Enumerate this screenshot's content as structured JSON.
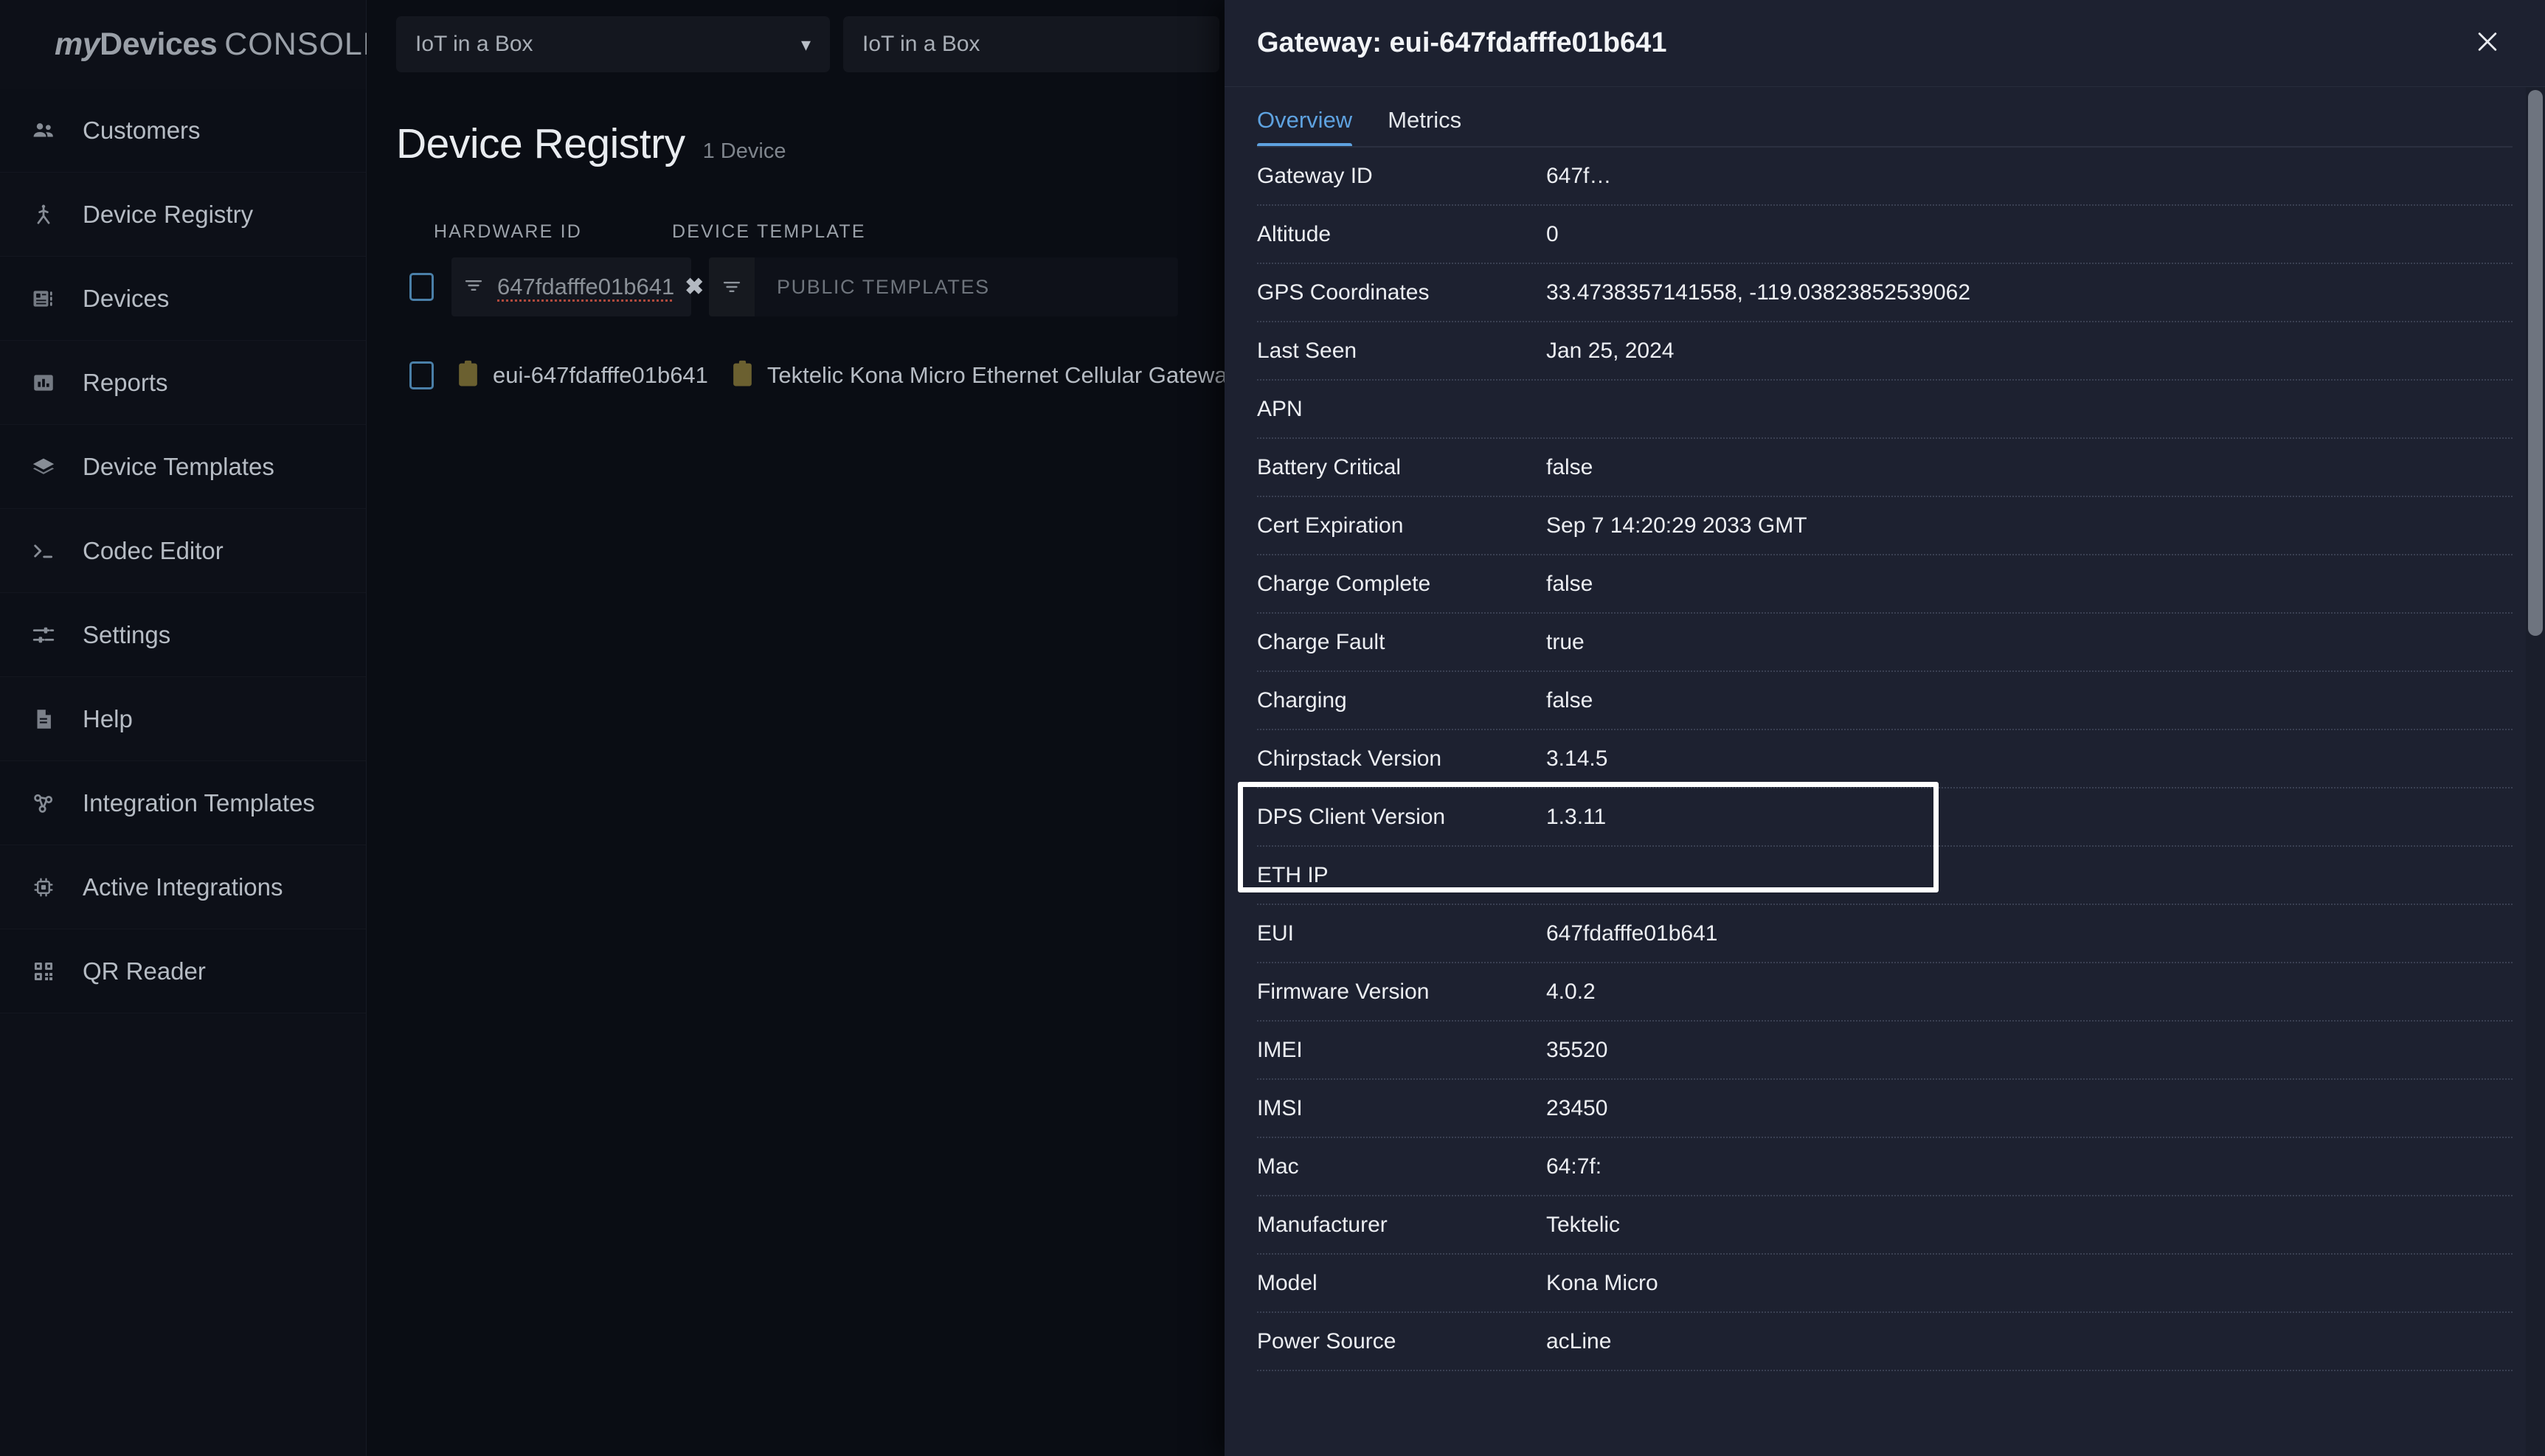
{
  "brand": {
    "my": "my",
    "devices": "Devices",
    "console": "CONSOLE"
  },
  "sidebar": {
    "items": [
      {
        "label": "Customers",
        "icon": "people-icon"
      },
      {
        "label": "Device Registry",
        "icon": "registry-icon"
      },
      {
        "label": "Devices",
        "icon": "devices-icon"
      },
      {
        "label": "Reports",
        "icon": "bar-chart-icon"
      },
      {
        "label": "Device Templates",
        "icon": "layers-icon"
      },
      {
        "label": "Codec Editor",
        "icon": "terminal-icon"
      },
      {
        "label": "Settings",
        "icon": "sliders-icon"
      },
      {
        "label": "Help",
        "icon": "document-icon"
      },
      {
        "label": "Integration Templates",
        "icon": "integration-icon"
      },
      {
        "label": "Active Integrations",
        "icon": "chip-icon"
      },
      {
        "label": "QR Reader",
        "icon": "qr-icon"
      }
    ]
  },
  "topbar": {
    "customer_select": {
      "value": "IoT in a Box",
      "icon": "chevron-down-icon"
    },
    "application_select": {
      "value": "IoT in a Box"
    }
  },
  "registry": {
    "title": "Device Registry",
    "count": "1 Device",
    "columns": {
      "hardware_id": "HARDWARE ID",
      "device_template": "DEVICE TEMPLATE"
    },
    "hardware_id_filter": {
      "value": "647fdafffe01b641",
      "clear_label": "✖",
      "icon": "filter-icon"
    },
    "template_filter": {
      "placeholder": "PUBLIC TEMPLATES",
      "icon": "filter-icon"
    },
    "rows": [
      {
        "hardware_id": "eui-647fdafffe01b641",
        "device_template": "Tektelic Kona Micro Ethernet Cellular Gateway"
      }
    ]
  },
  "panel": {
    "title": "Gateway: eui-647fdafffe01b641",
    "close_icon": "close-icon",
    "tabs": [
      {
        "label": "Overview",
        "active": true
      },
      {
        "label": "Metrics",
        "active": false
      }
    ],
    "properties": [
      {
        "key": "Gateway ID",
        "value": "647f…"
      },
      {
        "key": "Altitude",
        "value": "0"
      },
      {
        "key": "GPS Coordinates",
        "value": "33.4738357141558, -119.03823852539062"
      },
      {
        "key": "Last Seen",
        "value": "Jan 25, 2024"
      },
      {
        "key": "APN",
        "value": ""
      },
      {
        "key": "Battery Critical",
        "value": "false"
      },
      {
        "key": "Cert Expiration",
        "value": "Sep 7 14:20:29 2033 GMT"
      },
      {
        "key": "Charge Complete",
        "value": "false"
      },
      {
        "key": "Charge Fault",
        "value": "true"
      },
      {
        "key": "Charging",
        "value": "false"
      },
      {
        "key": "Chirpstack Version",
        "value": "3.14.5"
      },
      {
        "key": "DPS Client Version",
        "value": "1.3.11"
      },
      {
        "key": "ETH IP",
        "value": ""
      },
      {
        "key": "EUI",
        "value": "647fdafffe01b641"
      },
      {
        "key": "Firmware Version",
        "value": "4.0.2"
      },
      {
        "key": "IMEI",
        "value": "35520"
      },
      {
        "key": "IMSI",
        "value": "23450"
      },
      {
        "key": "Mac",
        "value": "64:7f:"
      },
      {
        "key": "Manufacturer",
        "value": "Tektelic"
      },
      {
        "key": "Model",
        "value": "Kona Micro"
      },
      {
        "key": "Power Source",
        "value": "acLine"
      }
    ],
    "highlight": {
      "start_index": 10,
      "end_index": 11
    }
  },
  "colors": {
    "accent_blue": "#5ea2e0",
    "panel_bg": "#1d2130",
    "page_bg": "#0a0d14",
    "sidebar_bg": "#0d1018",
    "highlight_border": "#ffffff",
    "spellcheck_underline": "#b14a3d",
    "checkbox_border": "#4a7fa8",
    "device_icon": "#6b6030"
  }
}
